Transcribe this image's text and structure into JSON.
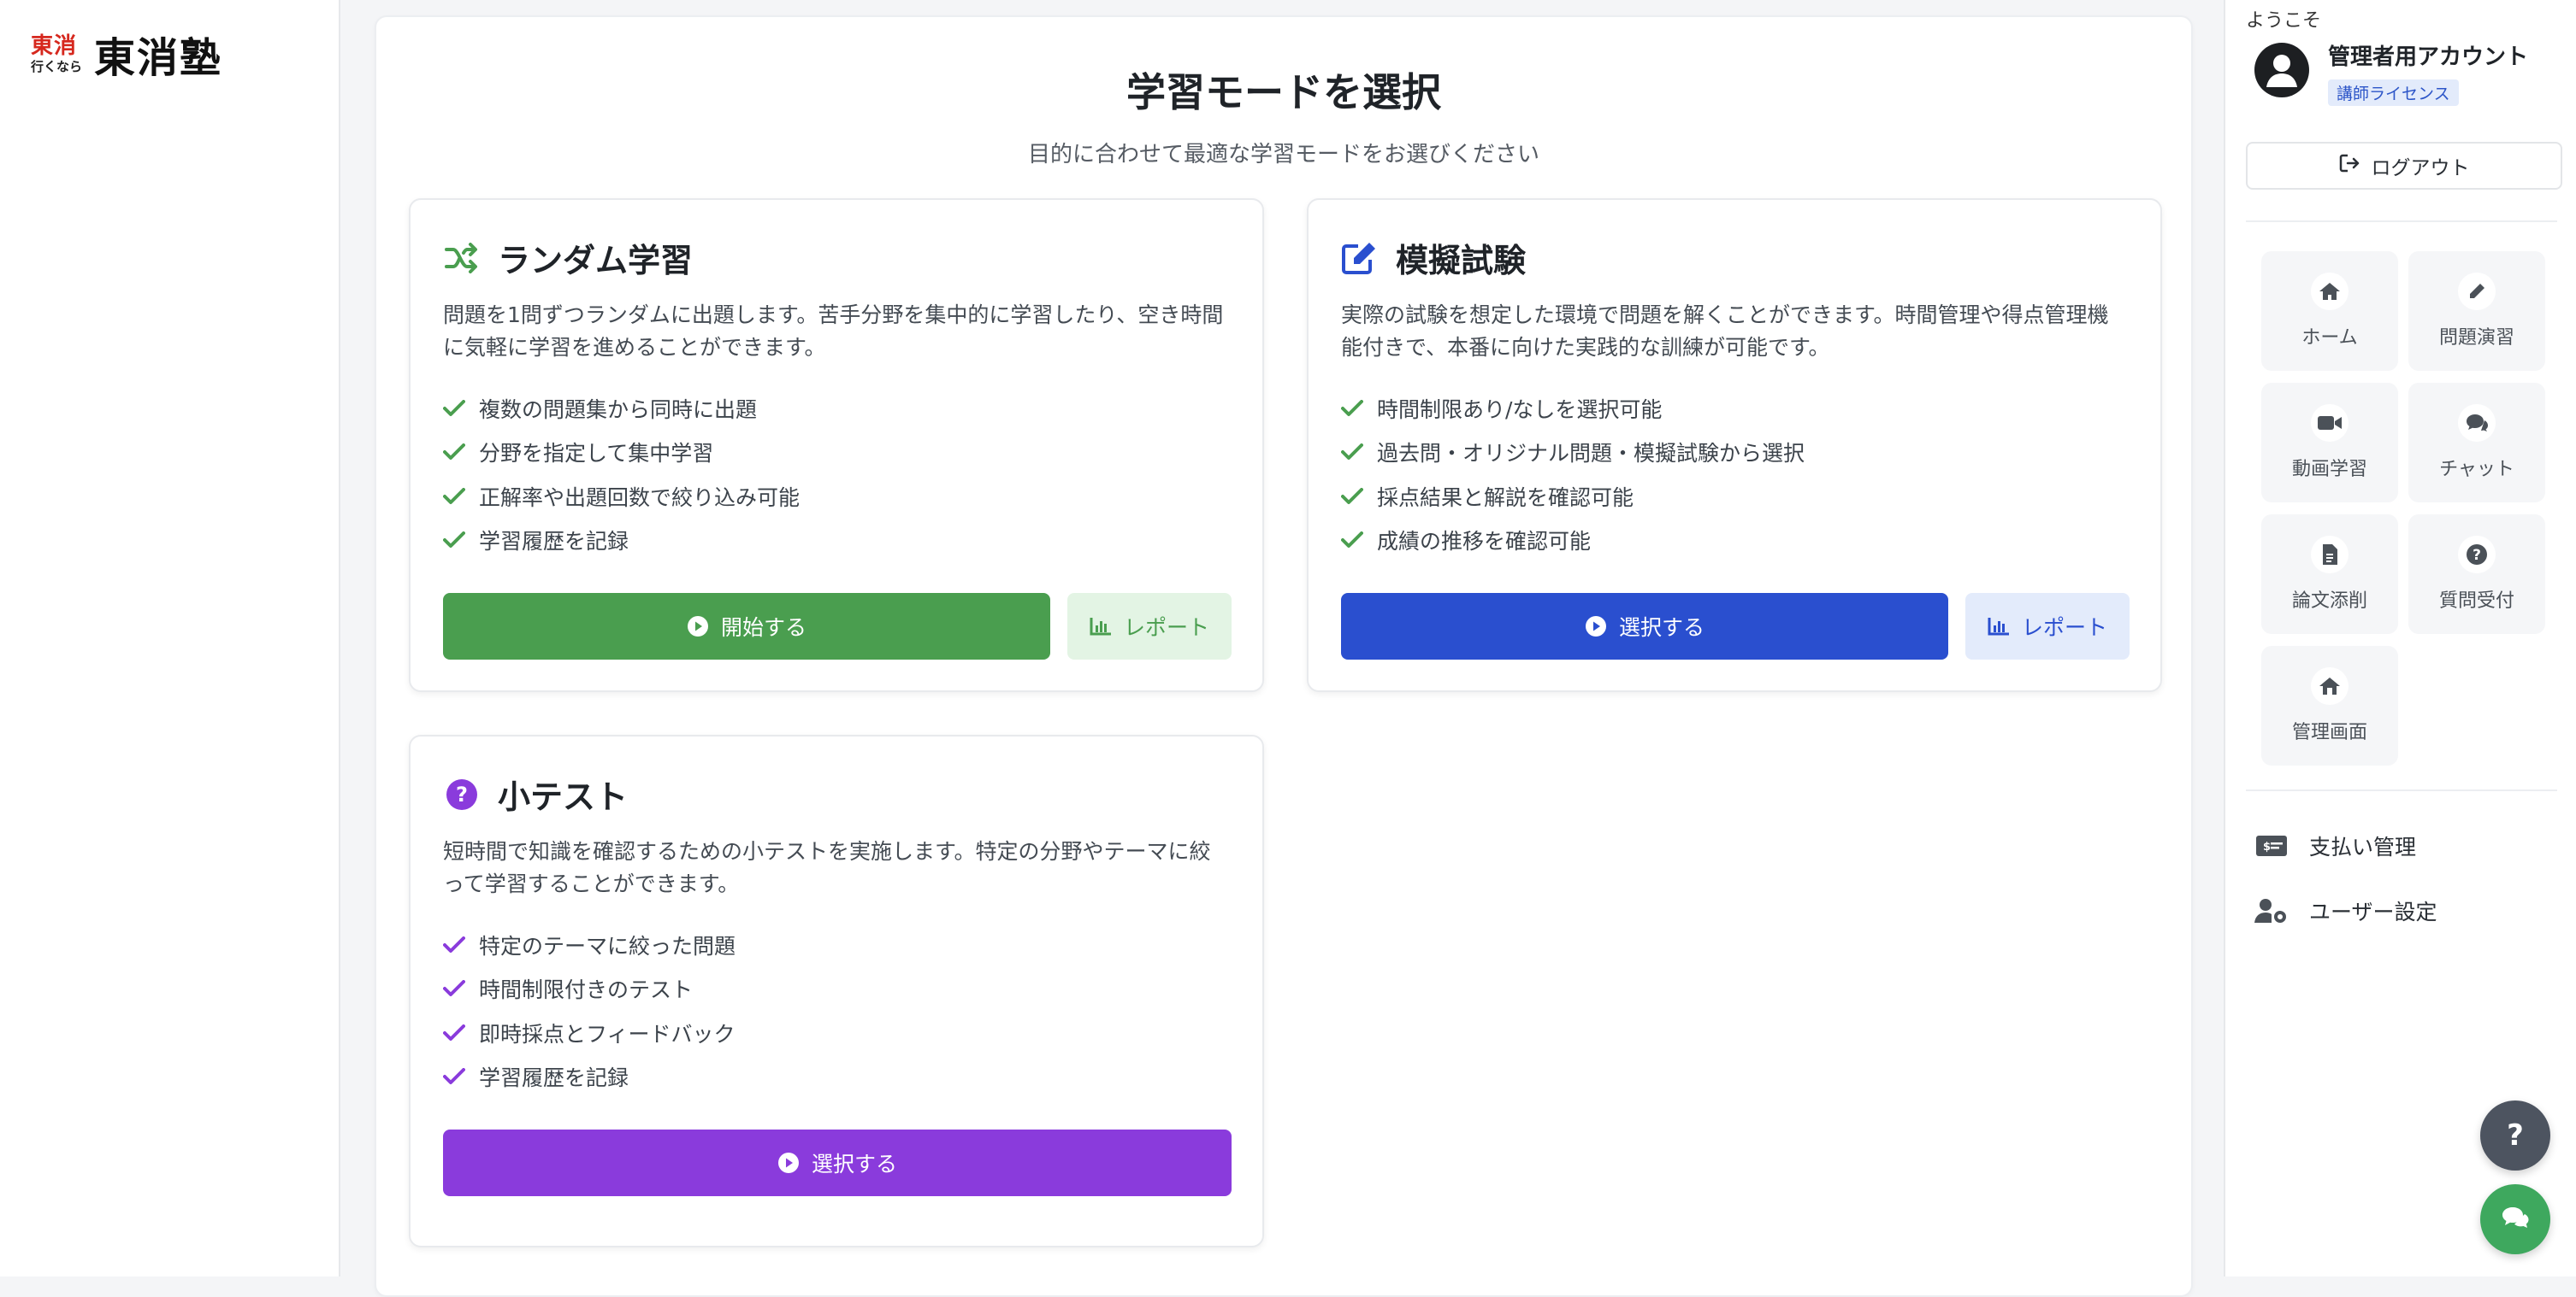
{
  "logo": {
    "red": "東消",
    "sub": "行くなら",
    "main": "東消塾"
  },
  "header": {
    "title": "学習モードを選択",
    "subtitle": "目的に合わせて最適な学習モードをお選びください"
  },
  "modes": {
    "random": {
      "title": "ランダム学習",
      "description": "問題を1問ずつランダムに出題します。苦手分野を集中的に学習したり、空き時間に気軽に学習を進めることができます。",
      "features": [
        "複数の問題集から同時に出題",
        "分野を指定して集中学習",
        "正解率や出題回数で絞り込み可能",
        "学習履歴を記録"
      ],
      "primary_label": "開始する",
      "report_label": "レポート",
      "color": "#4a9e4f",
      "icon": "shuffle-icon"
    },
    "mock": {
      "title": "模擬試験",
      "description": "実際の試験を想定した環境で問題を解くことができます。時間管理や得点管理機能付きで、本番に向けた実践的な訓練が可能です。",
      "features": [
        "時間制限あり/なしを選択可能",
        "過去問・オリジナル問題・模擬試験から選択",
        "採点結果と解説を確認可能",
        "成績の推移を確認可能"
      ],
      "primary_label": "選択する",
      "report_label": "レポート",
      "color": "#2a4fcf",
      "icon": "edit-icon"
    },
    "quiz": {
      "title": "小テスト",
      "description": "短時間で知識を確認するための小テストを実施します。特定の分野やテーマに絞って学習することができます。",
      "features": [
        "特定のテーマに絞った問題",
        "時間制限付きのテスト",
        "即時採点とフィードバック",
        "学習履歴を記録"
      ],
      "primary_label": "選択する",
      "color": "#8a3bdc",
      "icon": "question-circle-icon"
    }
  },
  "user": {
    "welcome": "ようこそ",
    "name": "管理者用アカウント",
    "badge": "講師ライセンス",
    "logout_label": "ログアウト"
  },
  "nav": {
    "tiles": [
      {
        "label": "ホーム",
        "icon": "home-icon"
      },
      {
        "label": "問題演習",
        "icon": "pencil-icon"
      },
      {
        "label": "動画学習",
        "icon": "video-icon"
      },
      {
        "label": "チャット",
        "icon": "chat-icon"
      },
      {
        "label": "論文添削",
        "icon": "document-icon"
      },
      {
        "label": "質問受付",
        "icon": "question-icon"
      },
      {
        "label": "管理画面",
        "icon": "admin-home-icon"
      }
    ],
    "links": [
      {
        "label": "支払い管理",
        "icon": "payment-card-icon"
      },
      {
        "label": "ユーザー設定",
        "icon": "user-settings-icon"
      }
    ]
  },
  "fabs": {
    "help_label": "?"
  }
}
